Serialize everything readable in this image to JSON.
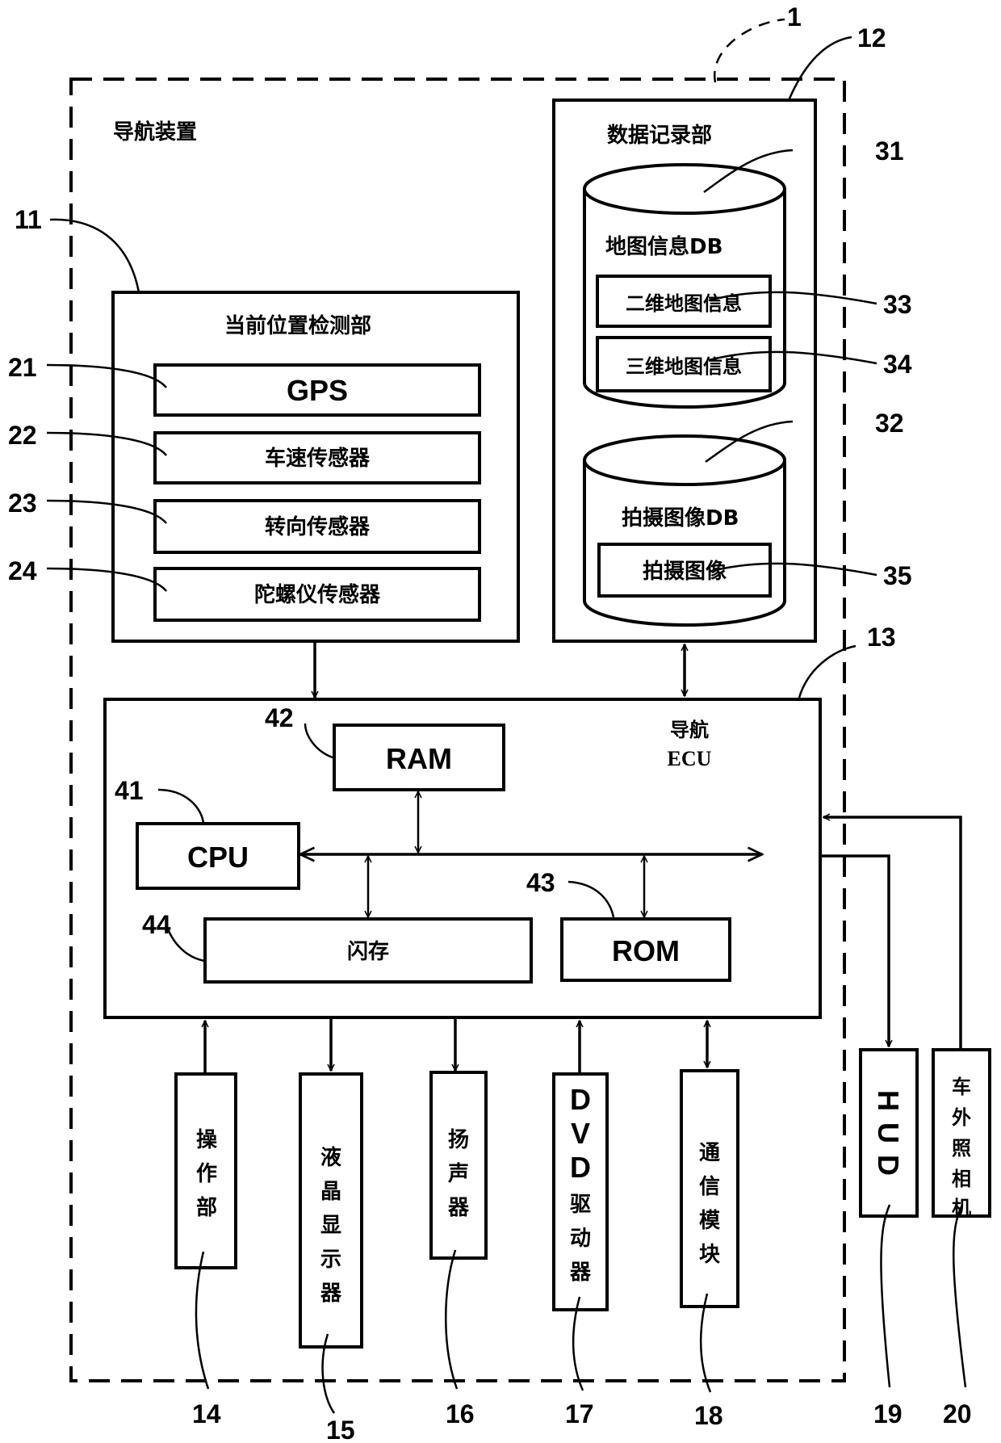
{
  "device": {
    "title": "导航装置",
    "ref": "1"
  },
  "current_position_detector": {
    "title": "当前位置检测部",
    "ref": "11",
    "items": [
      {
        "label": "GPS",
        "ref": "21"
      },
      {
        "label": "车速传感器",
        "ref": "22"
      },
      {
        "label": "转向传感器",
        "ref": "23"
      },
      {
        "label": "陀螺仪传感器",
        "ref": "24"
      }
    ]
  },
  "data_recording_unit": {
    "title": "数据记录部",
    "ref": "12",
    "map_db": {
      "label": "地图信息DB",
      "ref": "31",
      "items": [
        {
          "label": "二维地图信息",
          "ref": "33"
        },
        {
          "label": "三维地图信息",
          "ref": "34"
        }
      ]
    },
    "image_db": {
      "label": "拍摄图像DB",
      "ref": "32",
      "items": [
        {
          "label": "拍摄图像",
          "ref": "35"
        }
      ]
    }
  },
  "navigation_ecu": {
    "title_line1": "导航",
    "title_line2": "ECU",
    "ref": "13",
    "cpu": {
      "label": "CPU",
      "ref": "41"
    },
    "ram": {
      "label": "RAM",
      "ref": "42"
    },
    "rom": {
      "label": "ROM",
      "ref": "43"
    },
    "flash": {
      "label": "闪存",
      "ref": "44"
    }
  },
  "peripherals": [
    {
      "chars": [
        "操",
        "作",
        "部"
      ],
      "ref": "14",
      "direction": "to-ecu"
    },
    {
      "chars": [
        "液",
        "晶",
        "显",
        "示",
        "器"
      ],
      "ref": "15",
      "direction": "from-ecu"
    },
    {
      "chars": [
        "扬",
        "声",
        "器"
      ],
      "ref": "16",
      "direction": "from-ecu"
    },
    {
      "chars": [
        "D",
        "V",
        "D",
        "驱",
        "动",
        "器"
      ],
      "ref": "17",
      "direction": "to-ecu"
    },
    {
      "chars": [
        "通",
        "信",
        "模",
        "块"
      ],
      "ref": "18",
      "direction": "bidirectional"
    },
    {
      "chars": [
        "H",
        "U",
        "D"
      ],
      "ref": "19",
      "direction": "from-ecu"
    },
    {
      "chars": [
        "车",
        "外",
        "照",
        "相",
        "机"
      ],
      "ref": "20",
      "direction": "to-ecu"
    }
  ]
}
